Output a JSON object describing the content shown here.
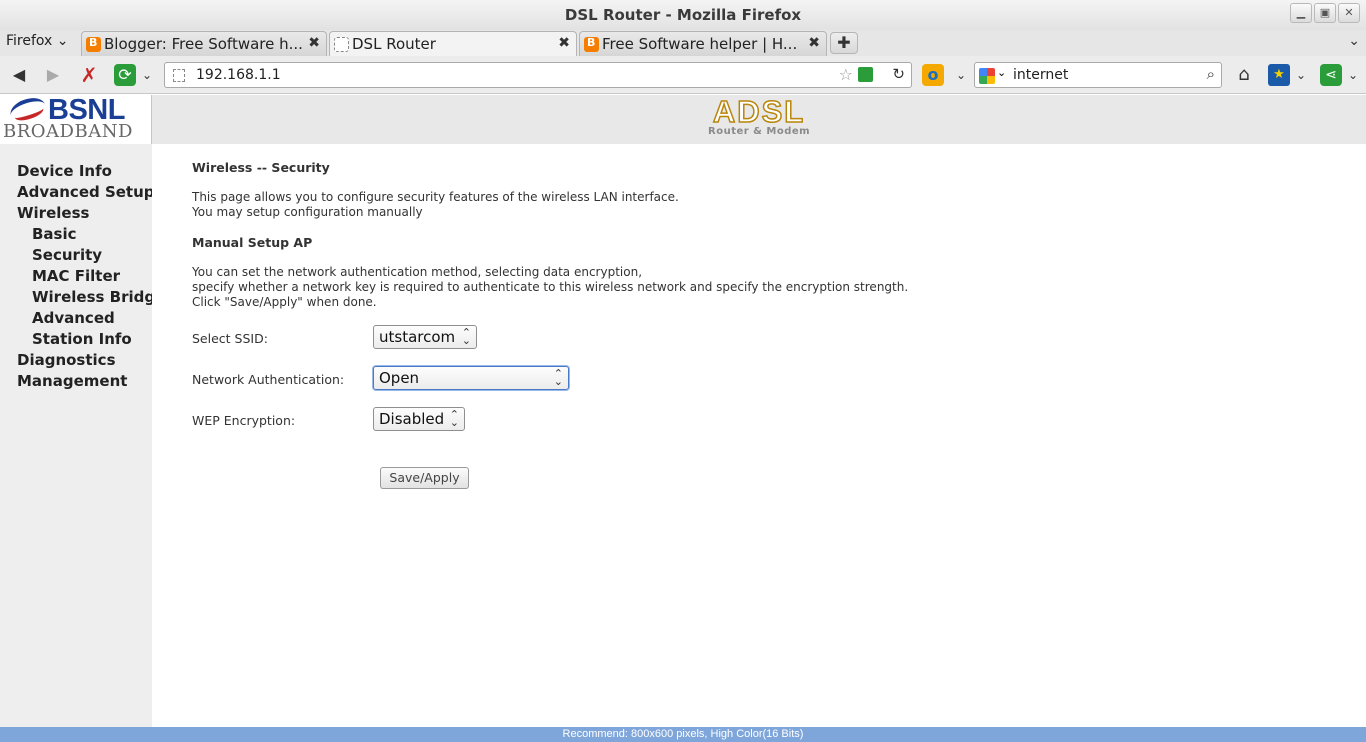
{
  "window": {
    "title": "DSL Router - Mozilla Firefox"
  },
  "browser": {
    "menu_label": "Firefox",
    "tabs": [
      {
        "label": "Blogger: Free Software h...",
        "favicon": "blogger-icon"
      },
      {
        "label": "DSL Router",
        "favicon": "blank-page-icon",
        "active": true
      },
      {
        "label": "Free Software helper | H...",
        "favicon": "blogger-icon"
      }
    ],
    "url": "192.168.1.1",
    "search_query": "internet"
  },
  "branding": {
    "logo_top": "BSNL",
    "logo_bottom": "BROADBAND",
    "product_big": "ADSL",
    "product_small": "Router & Modem"
  },
  "sidebar": {
    "items": [
      {
        "label": "Device Info",
        "level": 0
      },
      {
        "label": "Advanced Setup",
        "level": 0
      },
      {
        "label": "Wireless",
        "level": 0
      },
      {
        "label": "Basic",
        "level": 1
      },
      {
        "label": "Security",
        "level": 1
      },
      {
        "label": "MAC Filter",
        "level": 1
      },
      {
        "label": "Wireless Bridge",
        "level": 1
      },
      {
        "label": "Advanced",
        "level": 1
      },
      {
        "label": "Station Info",
        "level": 1
      },
      {
        "label": "Diagnostics",
        "level": 0
      },
      {
        "label": "Management",
        "level": 0
      }
    ]
  },
  "main": {
    "heading": "Wireless -- Security",
    "intro_line1": "This page allows you to configure security features of the wireless LAN interface.",
    "intro_line2": "You may setup configuration manually",
    "subheading": "Manual Setup AP",
    "desc_line1": "You can set the network authentication method, selecting data encryption,",
    "desc_line2": "specify whether a network key is required to authenticate to this wireless network and specify the encryption strength.",
    "desc_line3": "Click \"Save/Apply\" when done.",
    "fields": {
      "ssid_label": "Select SSID:",
      "ssid_value": "utstarcom",
      "auth_label": "Network Authentication:",
      "auth_value": "Open",
      "wep_label": "WEP Encryption:",
      "wep_value": "Disabled"
    },
    "save_label": "Save/Apply"
  },
  "footer": {
    "text": "Recommend: 800x600 pixels, High Color(16 Bits)"
  }
}
